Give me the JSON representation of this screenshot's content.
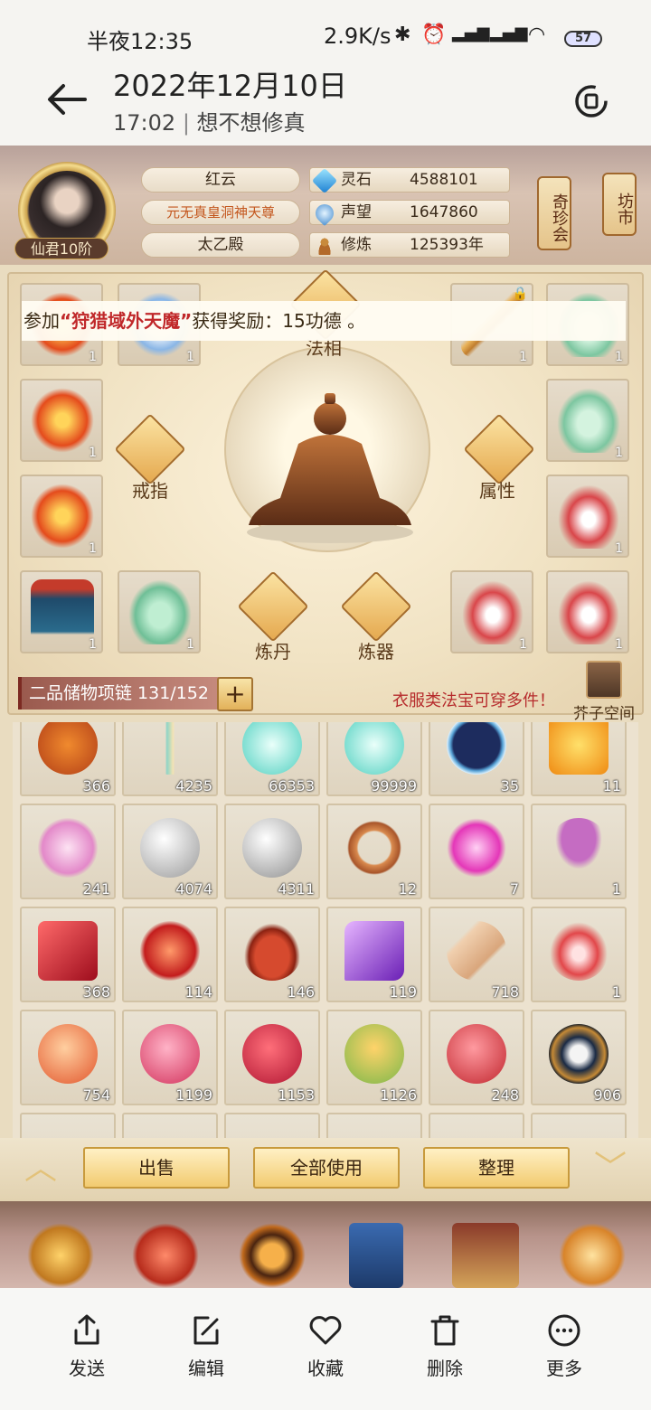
{
  "status": {
    "time": "半夜12:35",
    "network": "2.9K/s",
    "battery": "57"
  },
  "topbar": {
    "date": "2022年12月10日",
    "time": "17:02",
    "separator": "|",
    "subtitle": "想不想修真"
  },
  "game": {
    "player": {
      "name": "红云",
      "title": "元无真皇洞神天尊",
      "sect": "太乙殿",
      "rank": "仙君10阶"
    },
    "stats": [
      {
        "label": "灵石",
        "value": "4588101"
      },
      {
        "label": "声望",
        "value": "1647860"
      },
      {
        "label": "修炼",
        "value": "125393年"
      }
    ],
    "signs": [
      "奇珍会",
      "坊市"
    ],
    "toast": {
      "prefix": "参加",
      "highlight": "“狩猎域外天魔”",
      "suffix": "获得奖励：15功德 。"
    },
    "equip_labels": {
      "faxiang": "法相",
      "ring": "戒指",
      "attr": "属性",
      "alchemy": "炼丹",
      "forge": "炼器"
    },
    "equip_slots": [
      {
        "count": "1"
      },
      {
        "count": "1"
      },
      {
        "count": "1"
      },
      {
        "count": "1"
      },
      {
        "count": "1"
      },
      {
        "count": "1"
      },
      {
        "count": "1"
      },
      {
        "count": "1"
      },
      {
        "count": "1"
      },
      {
        "count": "1"
      },
      {
        "count": "1"
      },
      {
        "count": "1"
      }
    ],
    "storage": {
      "label": "二品储物项链 131/152",
      "plus": "+",
      "hint": "衣服类法宝可穿多件！",
      "space": "芥子空间"
    },
    "inventory": [
      "366",
      "4235",
      "66353",
      "99999",
      "35",
      "11",
      "241",
      "4074",
      "4311",
      "12",
      "7",
      "1",
      "368",
      "114",
      "146",
      "119",
      "718",
      "1",
      "754",
      "1199",
      "1153",
      "1126",
      "248",
      "906"
    ],
    "actions": {
      "sell": "出售",
      "use_all": "全部使用",
      "sort": "整理"
    }
  },
  "toolbar": {
    "send": "发送",
    "edit": "编辑",
    "favorite": "收藏",
    "delete": "删除",
    "more": "更多"
  },
  "colors": {
    "accent_red": "#c0282a",
    "gold": "#f2cb70"
  }
}
